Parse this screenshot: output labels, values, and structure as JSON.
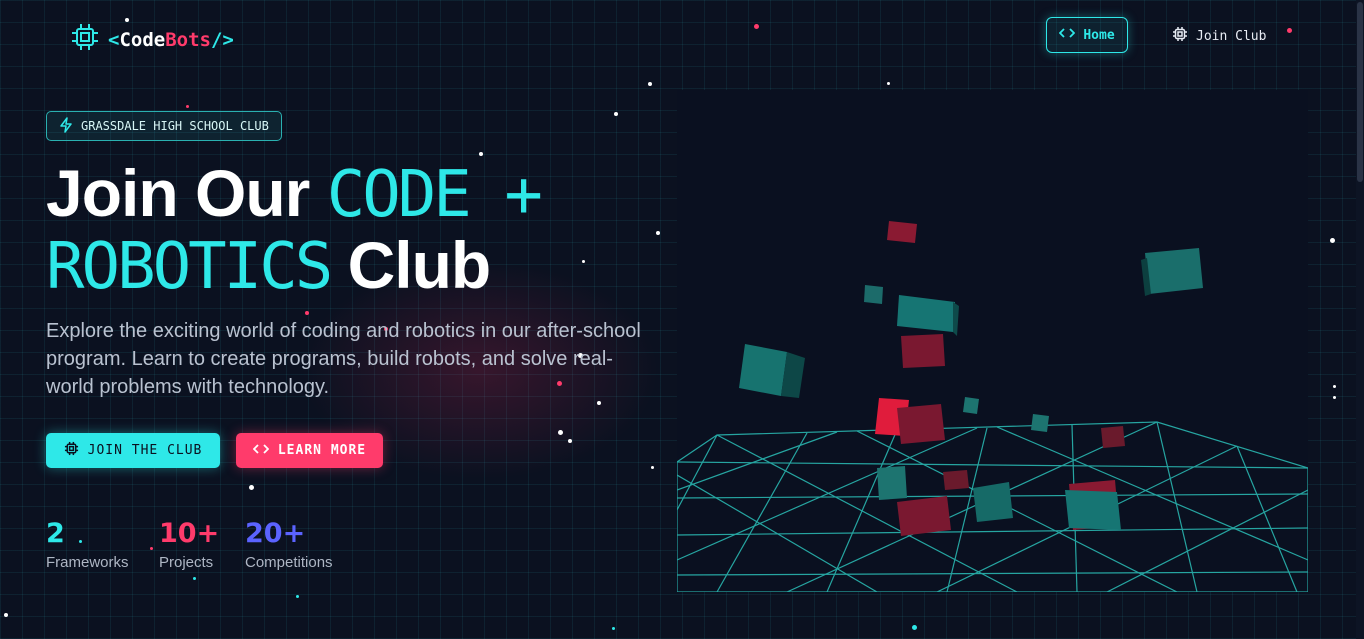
{
  "brand": {
    "open": "<",
    "code": "Code",
    "bots": "Bots",
    "close": "/>"
  },
  "nav": {
    "home_label": "Home",
    "join_label": "Join Club"
  },
  "hero": {
    "badge": "GRASSDALE HIGH SCHOOL CLUB",
    "title_part1": "Join Our ",
    "title_highlight1": "CODE +",
    "title_highlight2": "ROBOTICS",
    "title_part2": " Club",
    "description": "Explore the exciting world of coding and robotics in our after-school program. Learn to create programs, build robots, and solve real-world problems with technology.",
    "btn_join": "JOIN THE CLUB",
    "btn_learn": "LEARN MORE"
  },
  "stats": [
    {
      "value": "2",
      "label": "Frameworks",
      "color": "#2ee8e8"
    },
    {
      "value": "10+",
      "label": "Projects",
      "color": "#ff3b6b"
    },
    {
      "value": "20+",
      "label": "Competitions",
      "color": "#5b63ff"
    }
  ],
  "colors": {
    "accent": "#2ee8e8",
    "pink": "#ff3b6b",
    "indigo": "#5b63ff",
    "background": "#0b1120"
  },
  "icons": {
    "logo": "chip-icon",
    "home": "code-brackets-icon",
    "join": "chip-icon",
    "badge": "lightning-icon"
  }
}
